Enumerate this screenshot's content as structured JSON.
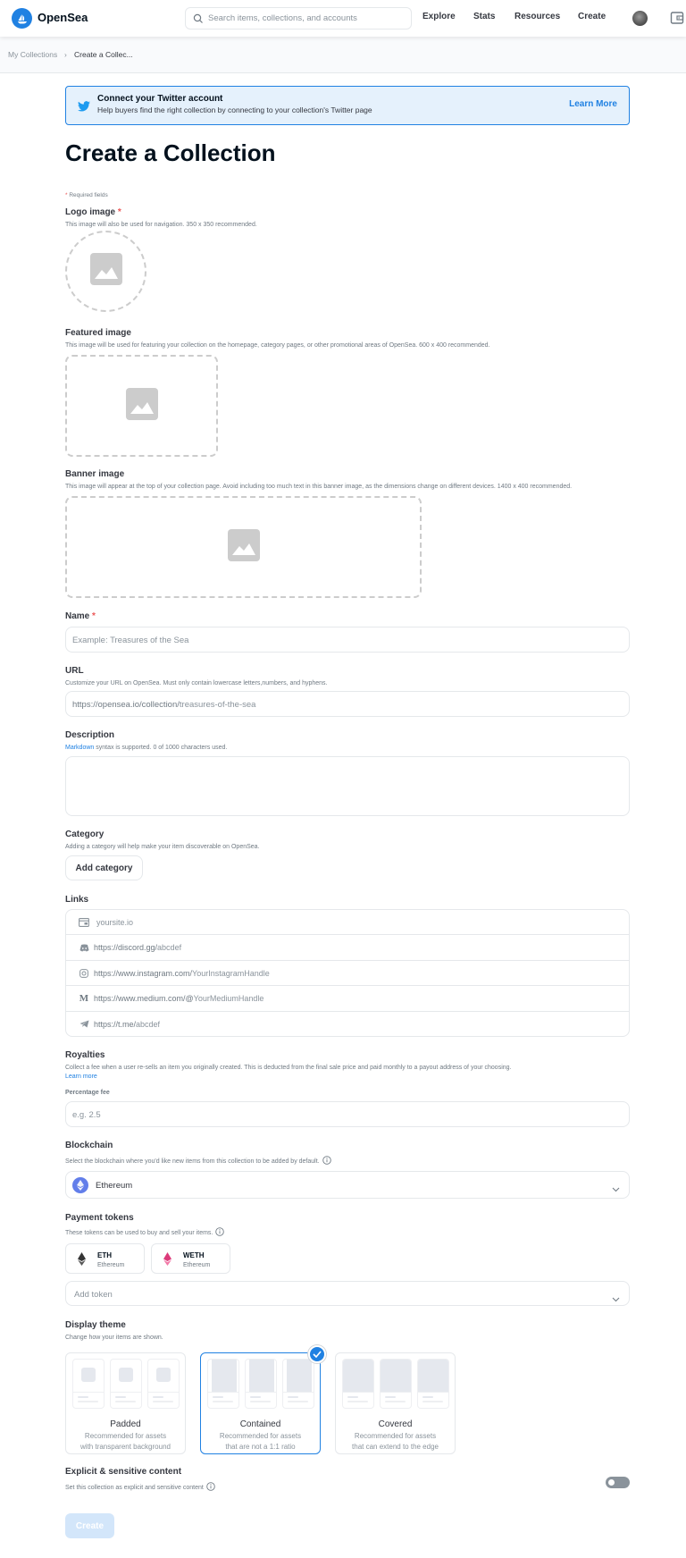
{
  "header": {
    "brand": "OpenSea",
    "search_placeholder": "Search items, collections, and accounts",
    "nav": [
      "Explore",
      "Stats",
      "Resources",
      "Create"
    ],
    "brand_color": "#2081e2"
  },
  "breadcrumb": {
    "items": [
      "My Collections",
      "Create a Collec..."
    ],
    "separator": "›"
  },
  "twitter_banner": {
    "title": "Connect your Twitter account",
    "subtitle": "Help buyers find the right collection by connecting to your collection's Twitter page",
    "link": "Learn More"
  },
  "page_title": "Create a Collection",
  "required_note": {
    "star": "*",
    "text": " Required fields"
  },
  "logo_image": {
    "label": "Logo image",
    "required": "*",
    "hint": "This image will also be used for navigation. 350 x 350 recommended."
  },
  "featured_image": {
    "label": "Featured image",
    "hint": "This image will be used for featuring your collection on the homepage, category pages, or other promotional areas of OpenSea. 600 x 400 recommended."
  },
  "banner_image": {
    "label": "Banner image",
    "hint": "This image will appear at the top of your collection page. Avoid including too much text in this banner image, as the dimensions change on different devices. 1400 x 400 recommended."
  },
  "name": {
    "label": "Name",
    "required": "*",
    "placeholder": "Example: Treasures of the Sea",
    "value": ""
  },
  "url": {
    "label": "URL",
    "hint": "Customize your URL on OpenSea. Must only contain lowercase letters,numbers, and hyphens.",
    "prefix": "https://opensea.io/collection/",
    "placeholder": "treasures-of-the-sea"
  },
  "description": {
    "label": "Description",
    "hint_link": "Markdown",
    "hint_rest": " syntax is supported. 0 of 1000 characters used.",
    "value": ""
  },
  "category": {
    "label": "Category",
    "hint": "Adding a category will help make your item discoverable on OpenSea.",
    "button": "Add category"
  },
  "links": {
    "label": "Links",
    "rows": [
      {
        "icon": "website-icon",
        "prefix": "",
        "placeholder": "yoursite.io"
      },
      {
        "icon": "discord-icon",
        "prefix": "https://discord.gg/",
        "placeholder": "abcdef"
      },
      {
        "icon": "instagram-icon",
        "prefix": "https://www.instagram.com/",
        "placeholder": "YourInstagramHandle"
      },
      {
        "icon": "medium-icon",
        "prefix": "https://www.medium.com/@",
        "placeholder": "YourMediumHandle"
      },
      {
        "icon": "telegram-icon",
        "prefix": "https://t.me/",
        "placeholder": "abcdef"
      }
    ]
  },
  "royalties": {
    "label": "Royalties",
    "hint": "Collect a fee when a user re-sells an item you originally created. This is deducted from the final sale price and paid monthly to a payout address of your choosing.",
    "learn_more": "Learn more",
    "fee_label": "Percentage fee",
    "fee_placeholder": "e.g. 2.5"
  },
  "blockchain": {
    "label": "Blockchain",
    "hint": "Select the blockchain where you'd like new items from this collection to be added by default.",
    "selected": "Ethereum"
  },
  "payment_tokens": {
    "label": "Payment tokens",
    "hint": "These tokens can be used to buy and sell your items.",
    "tokens": [
      {
        "symbol": "ETH",
        "chain": "Ethereum"
      },
      {
        "symbol": "WETH",
        "chain": "Ethereum"
      }
    ],
    "add_placeholder": "Add token"
  },
  "display_theme": {
    "label": "Display theme",
    "hint": "Change how your items are shown.",
    "options": [
      {
        "title": "Padded",
        "desc1": "Recommended for assets",
        "desc2": "with transparent background"
      },
      {
        "title": "Contained",
        "desc1": "Recommended for assets",
        "desc2": "that are not a 1:1 ratio"
      },
      {
        "title": "Covered",
        "desc1": "Recommended for assets",
        "desc2": "that can extend to the edge"
      }
    ],
    "selected": "Contained"
  },
  "explicit": {
    "label": "Explicit & sensitive content",
    "hint": "Set this collection as explicit and sensitive content",
    "enabled": false
  },
  "submit": {
    "label": "Create",
    "disabled": true
  }
}
